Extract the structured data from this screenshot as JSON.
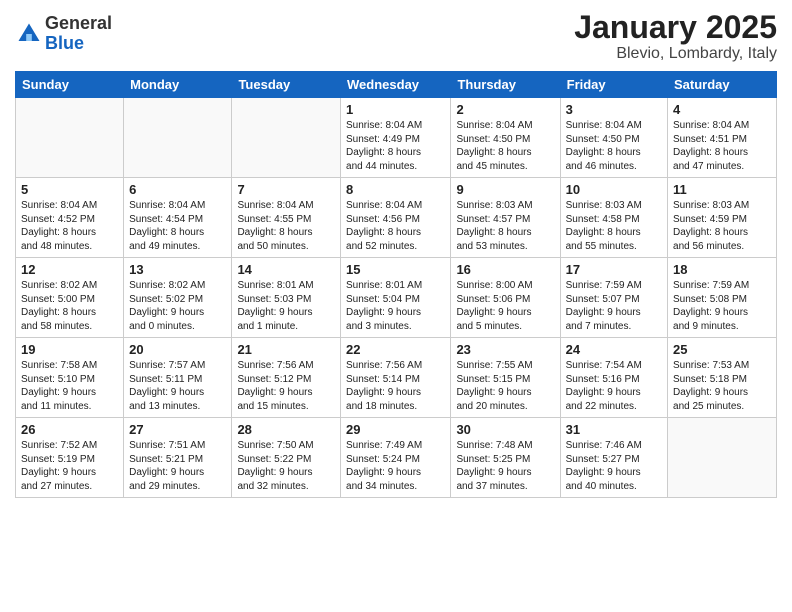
{
  "header": {
    "logo_general": "General",
    "logo_blue": "Blue",
    "month_year": "January 2025",
    "location": "Blevio, Lombardy, Italy"
  },
  "days_of_week": [
    "Sunday",
    "Monday",
    "Tuesday",
    "Wednesday",
    "Thursday",
    "Friday",
    "Saturday"
  ],
  "weeks": [
    [
      {
        "day": "",
        "info": ""
      },
      {
        "day": "",
        "info": ""
      },
      {
        "day": "",
        "info": ""
      },
      {
        "day": "1",
        "info": "Sunrise: 8:04 AM\nSunset: 4:49 PM\nDaylight: 8 hours\nand 44 minutes."
      },
      {
        "day": "2",
        "info": "Sunrise: 8:04 AM\nSunset: 4:50 PM\nDaylight: 8 hours\nand 45 minutes."
      },
      {
        "day": "3",
        "info": "Sunrise: 8:04 AM\nSunset: 4:50 PM\nDaylight: 8 hours\nand 46 minutes."
      },
      {
        "day": "4",
        "info": "Sunrise: 8:04 AM\nSunset: 4:51 PM\nDaylight: 8 hours\nand 47 minutes."
      }
    ],
    [
      {
        "day": "5",
        "info": "Sunrise: 8:04 AM\nSunset: 4:52 PM\nDaylight: 8 hours\nand 48 minutes."
      },
      {
        "day": "6",
        "info": "Sunrise: 8:04 AM\nSunset: 4:54 PM\nDaylight: 8 hours\nand 49 minutes."
      },
      {
        "day": "7",
        "info": "Sunrise: 8:04 AM\nSunset: 4:55 PM\nDaylight: 8 hours\nand 50 minutes."
      },
      {
        "day": "8",
        "info": "Sunrise: 8:04 AM\nSunset: 4:56 PM\nDaylight: 8 hours\nand 52 minutes."
      },
      {
        "day": "9",
        "info": "Sunrise: 8:03 AM\nSunset: 4:57 PM\nDaylight: 8 hours\nand 53 minutes."
      },
      {
        "day": "10",
        "info": "Sunrise: 8:03 AM\nSunset: 4:58 PM\nDaylight: 8 hours\nand 55 minutes."
      },
      {
        "day": "11",
        "info": "Sunrise: 8:03 AM\nSunset: 4:59 PM\nDaylight: 8 hours\nand 56 minutes."
      }
    ],
    [
      {
        "day": "12",
        "info": "Sunrise: 8:02 AM\nSunset: 5:00 PM\nDaylight: 8 hours\nand 58 minutes."
      },
      {
        "day": "13",
        "info": "Sunrise: 8:02 AM\nSunset: 5:02 PM\nDaylight: 9 hours\nand 0 minutes."
      },
      {
        "day": "14",
        "info": "Sunrise: 8:01 AM\nSunset: 5:03 PM\nDaylight: 9 hours\nand 1 minute."
      },
      {
        "day": "15",
        "info": "Sunrise: 8:01 AM\nSunset: 5:04 PM\nDaylight: 9 hours\nand 3 minutes."
      },
      {
        "day": "16",
        "info": "Sunrise: 8:00 AM\nSunset: 5:06 PM\nDaylight: 9 hours\nand 5 minutes."
      },
      {
        "day": "17",
        "info": "Sunrise: 7:59 AM\nSunset: 5:07 PM\nDaylight: 9 hours\nand 7 minutes."
      },
      {
        "day": "18",
        "info": "Sunrise: 7:59 AM\nSunset: 5:08 PM\nDaylight: 9 hours\nand 9 minutes."
      }
    ],
    [
      {
        "day": "19",
        "info": "Sunrise: 7:58 AM\nSunset: 5:10 PM\nDaylight: 9 hours\nand 11 minutes."
      },
      {
        "day": "20",
        "info": "Sunrise: 7:57 AM\nSunset: 5:11 PM\nDaylight: 9 hours\nand 13 minutes."
      },
      {
        "day": "21",
        "info": "Sunrise: 7:56 AM\nSunset: 5:12 PM\nDaylight: 9 hours\nand 15 minutes."
      },
      {
        "day": "22",
        "info": "Sunrise: 7:56 AM\nSunset: 5:14 PM\nDaylight: 9 hours\nand 18 minutes."
      },
      {
        "day": "23",
        "info": "Sunrise: 7:55 AM\nSunset: 5:15 PM\nDaylight: 9 hours\nand 20 minutes."
      },
      {
        "day": "24",
        "info": "Sunrise: 7:54 AM\nSunset: 5:16 PM\nDaylight: 9 hours\nand 22 minutes."
      },
      {
        "day": "25",
        "info": "Sunrise: 7:53 AM\nSunset: 5:18 PM\nDaylight: 9 hours\nand 25 minutes."
      }
    ],
    [
      {
        "day": "26",
        "info": "Sunrise: 7:52 AM\nSunset: 5:19 PM\nDaylight: 9 hours\nand 27 minutes."
      },
      {
        "day": "27",
        "info": "Sunrise: 7:51 AM\nSunset: 5:21 PM\nDaylight: 9 hours\nand 29 minutes."
      },
      {
        "day": "28",
        "info": "Sunrise: 7:50 AM\nSunset: 5:22 PM\nDaylight: 9 hours\nand 32 minutes."
      },
      {
        "day": "29",
        "info": "Sunrise: 7:49 AM\nSunset: 5:24 PM\nDaylight: 9 hours\nand 34 minutes."
      },
      {
        "day": "30",
        "info": "Sunrise: 7:48 AM\nSunset: 5:25 PM\nDaylight: 9 hours\nand 37 minutes."
      },
      {
        "day": "31",
        "info": "Sunrise: 7:46 AM\nSunset: 5:27 PM\nDaylight: 9 hours\nand 40 minutes."
      },
      {
        "day": "",
        "info": ""
      }
    ]
  ]
}
